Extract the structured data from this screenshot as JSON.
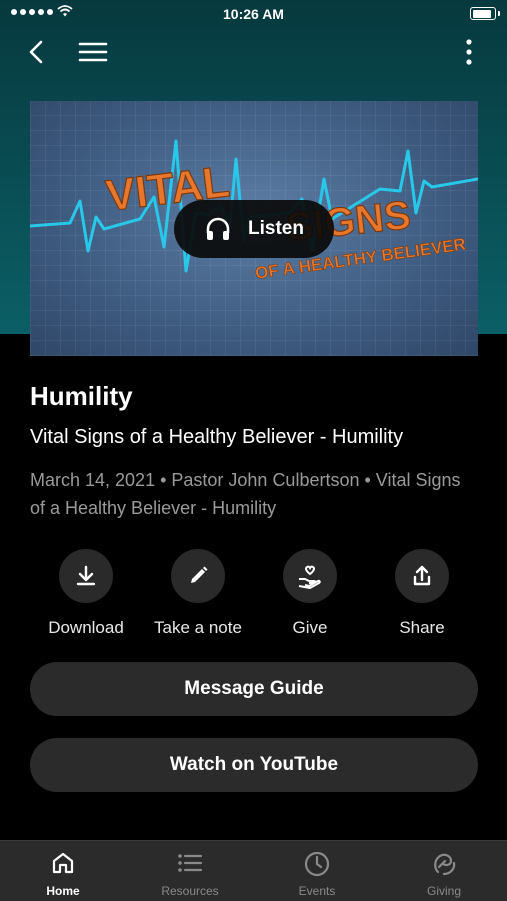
{
  "status_bar": {
    "time": "10:26 AM"
  },
  "nav": {
    "back_icon": "chevron-left-icon",
    "menu_icon": "hamburger-icon",
    "more_icon": "more-vertical-icon"
  },
  "artwork": {
    "line1": "VITAL",
    "line2": "SIGNS",
    "line3": "OF A HEALTHY BELIEVER",
    "listen_label": "Listen",
    "colors": {
      "accent_orange": "#e8762b",
      "pulse_cyan": "#27c8ea",
      "background_blue": "#4a6a92"
    }
  },
  "sermon": {
    "title": "Humility",
    "subtitle": "Vital Signs of a Healthy Believer - Humility",
    "meta": "March 14, 2021 • Pastor John Culbertson • Vital Signs of a Healthy Believer - Humility"
  },
  "actions": [
    {
      "label": "Download",
      "icon": "download-icon"
    },
    {
      "label": "Take a note",
      "icon": "pencil-icon"
    },
    {
      "label": "Give",
      "icon": "give-heart-hand-icon"
    },
    {
      "label": "Share",
      "icon": "share-icon"
    }
  ],
  "buttons": {
    "message_guide": "Message Guide",
    "watch_youtube": "Watch on YouTube"
  },
  "tabbar": {
    "active": "Home",
    "items": [
      {
        "label": "Home",
        "icon": "home-icon"
      },
      {
        "label": "Resources",
        "icon": "list-icon"
      },
      {
        "label": "Events",
        "icon": "clock-icon"
      },
      {
        "label": "Giving",
        "icon": "giving-icon"
      }
    ]
  },
  "theme": {
    "header_teal": "#0b5f66",
    "background": "#000000",
    "surface": "#2b2b2b"
  }
}
